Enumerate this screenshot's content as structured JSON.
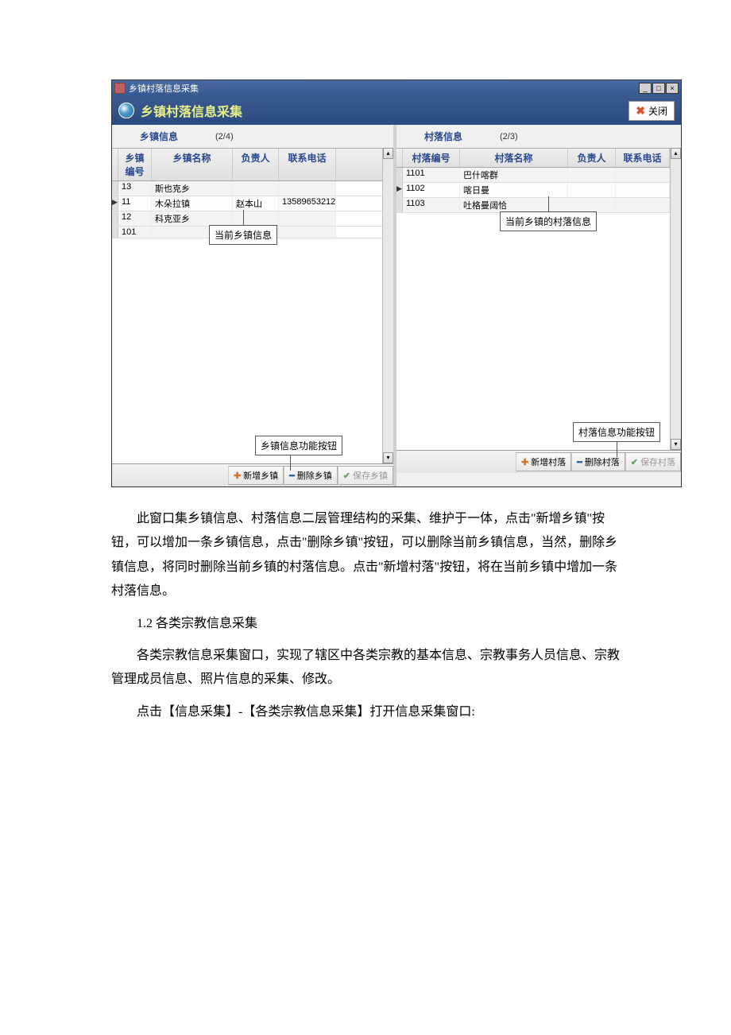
{
  "window": {
    "title": "乡镇村落信息采集",
    "header_title": "乡镇村落信息采集",
    "close_label": "关闭"
  },
  "left": {
    "section_title": "乡镇信息",
    "counter": "(2/4)",
    "headers": {
      "code": "乡镇编号",
      "name": "乡镇名称",
      "person": "负责人",
      "phone": "联系电话"
    },
    "rows": [
      {
        "code": "13",
        "name": "斯也克乡",
        "person": "",
        "phone": "",
        "sel": false
      },
      {
        "code": "11",
        "name": "木朵拉镇",
        "person": "赵本山",
        "phone": "13589653212",
        "sel": true
      },
      {
        "code": "12",
        "name": "科克亚乡",
        "person": "",
        "phone": "",
        "sel": false
      },
      {
        "code": "101",
        "name": "",
        "person": "",
        "phone": "",
        "sel": false
      }
    ],
    "callout": "当前乡镇信息",
    "callout_buttons": "乡镇信息功能按钮",
    "actions": {
      "add": "新增乡镇",
      "del": "删除乡镇",
      "save": "保存乡镇"
    }
  },
  "right": {
    "section_title": "村落信息",
    "counter": "(2/3)",
    "headers": {
      "code": "村落编号",
      "name": "村落名称",
      "person": "负责人",
      "phone": "联系电话"
    },
    "rows": [
      {
        "code": "1101",
        "name": "巴什喀群",
        "person": "",
        "phone": "",
        "sel": false
      },
      {
        "code": "1102",
        "name": "喀日曼",
        "person": "",
        "phone": "",
        "sel": true
      },
      {
        "code": "1103",
        "name": "吐格曼阔恰",
        "person": "",
        "phone": "",
        "sel": false
      }
    ],
    "callout": "当前乡镇的村落信息",
    "callout_buttons": "村落信息功能按钮",
    "actions": {
      "add": "新增村落",
      "del": "删除村落",
      "save": "保存村落"
    }
  },
  "article": {
    "p1": "此窗口集乡镇信息、村落信息二层管理结构的采集、维护于一体，点击\"新增乡镇\"按钮，可以增加一条乡镇信息，点击\"删除乡镇\"按钮，可以删除当前乡镇信息，当然，删除乡镇信息，将同时删除当前乡镇的村落信息。点击\"新增村落\"按钮，将在当前乡镇中增加一条村落信息。",
    "p2": "1.2 各类宗教信息采集",
    "p3": "各类宗教信息采集窗口，实现了辖区中各类宗教的基本信息、宗教事务人员信息、宗教管理成员信息、照片信息的采集、修改。",
    "p4": "点击【信息采集】-【各类宗教信息采集】打开信息采集窗口:"
  }
}
